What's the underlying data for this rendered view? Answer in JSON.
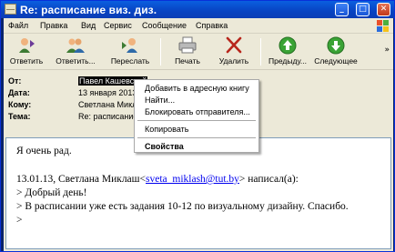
{
  "window": {
    "title": "Re: расписание виз. диз.",
    "minimize_glyph": "_",
    "maximize_glyph": "□",
    "close_glyph": "✕"
  },
  "menu": [
    "Файл",
    "Правка",
    "Вид",
    "Сервис",
    "Сообщение",
    "Справка"
  ],
  "toolbar": {
    "reply": "Ответить",
    "reply_all": "Ответить...",
    "forward": "Переслать",
    "print": "Печать",
    "delete": "Удалить",
    "prev": "Предыду...",
    "next": "Следующее"
  },
  "headers": {
    "from_label": "От:",
    "from_value": "Павел Кашевский",
    "date_label": "Дата:",
    "date_value": "13 января 2013",
    "to_label": "Кому:",
    "to_value": "Светлана Миклаш",
    "subject_label": "Тема:",
    "subject_value": "Re: расписание"
  },
  "message": {
    "greeting": "Я очень рад.",
    "quote_intro_prefix": "13.01.13, Светлана Миклаш<",
    "quote_email": "sveta_miklash@tut.by",
    "quote_intro_suffix": "> написал(а):",
    "quote1": "> Добрый день!",
    "quote2": "> В расписании уже есть задания 10-12 по визуальному дизайну. Спасибо.",
    "quote3": ">"
  },
  "context_menu": {
    "add_to_address_book": "Добавить в адресную книгу",
    "find": "Найти...",
    "block_sender": "Блокировать отправителя...",
    "copy": "Копировать",
    "properties": "Свойства"
  },
  "colors": {
    "titlebar": "#0843c2",
    "chrome": "#ece9d8",
    "link": "#0000ee",
    "go_green": "#3aa335",
    "delete_red": "#b8261c"
  }
}
